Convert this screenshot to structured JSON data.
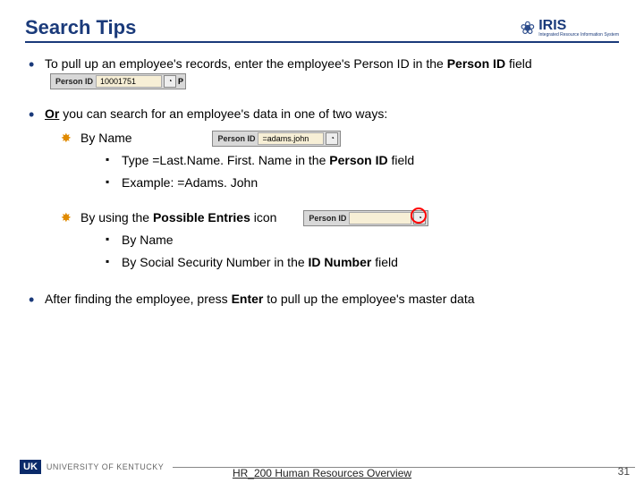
{
  "title": "Search Tips",
  "logo": {
    "brand": "IRIS",
    "tagline": "Integrated Resource Information System"
  },
  "bullets": {
    "b1a": "To pull up an employee's records, enter the employee's Person ID in the ",
    "b1b": "Person ID",
    "b1c": "field",
    "b2a": "Or",
    "b2b": " you can search for an employee's data in one of two ways:",
    "b3a": "After finding the employee, press ",
    "b3b": "Enter",
    "b3c": " to pull up the employee's master data"
  },
  "snip1": {
    "label": "Person ID",
    "value": "10001751",
    "suffix": "P"
  },
  "star1": {
    "head": "By Name",
    "s1a": "Type =Last.Name. First. Name in the ",
    "s1b": "Person ID",
    "s1c": " field",
    "s2": "Example: =Adams. John"
  },
  "snip2": {
    "label": "Person ID",
    "value": "=adams.john"
  },
  "star2": {
    "heada": "By using the ",
    "headb": "Possible Entries",
    "headc": " icon",
    "s1": "By Name",
    "s2a": "By Social Security Number in the ",
    "s2b": "ID Number",
    "s2c": " field"
  },
  "snip3": {
    "label": "Person ID",
    "value": ""
  },
  "footer": {
    "uk": "UK",
    "uktext": "UNIVERSITY OF KENTUCKY",
    "doc": "HR_200 Human Resources Overview",
    "page": "31"
  }
}
